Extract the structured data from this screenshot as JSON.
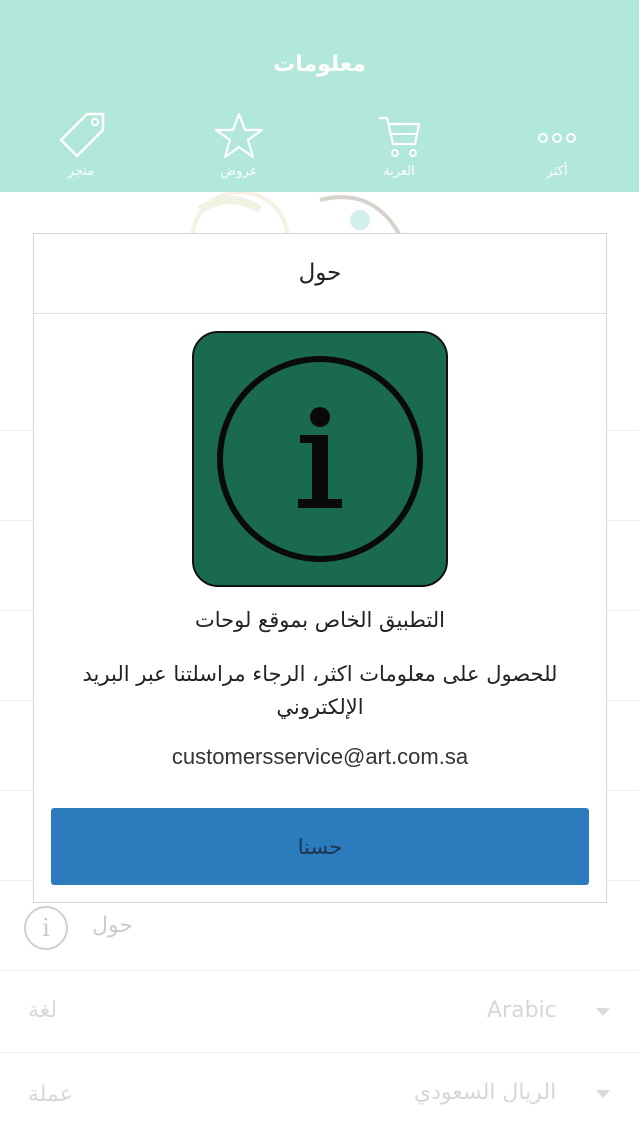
{
  "header": {
    "title": "معلومات",
    "tabs": [
      {
        "label": "متجر",
        "icon": "tag-icon"
      },
      {
        "label": "عروض",
        "icon": "star-icon"
      },
      {
        "label": "العربة",
        "icon": "cart-icon"
      },
      {
        "label": "أكثر",
        "icon": "more-icon"
      }
    ]
  },
  "list": {
    "about_label": "حول",
    "language_label": "لغة",
    "language_value": "Arabic",
    "currency_label": "عملة",
    "currency_value": "الريال السعودي"
  },
  "modal": {
    "title": "حول",
    "line1": "التطبيق الخاص بموقع لوحات",
    "line2": "للحصول على معلومات اكثر، الرجاء مراسلتنا عبر البريد الإلكتروني",
    "email": "customersservice@art.com.sa",
    "ok_label": "حسنا"
  },
  "colors": {
    "header_bg": "#b2e8d9",
    "info_icon_bg": "#1a6b4e",
    "ok_button_bg": "#2b7bbd"
  }
}
